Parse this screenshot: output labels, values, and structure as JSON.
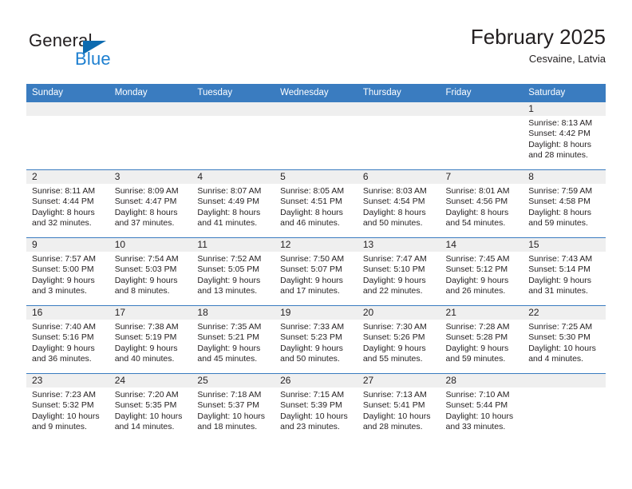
{
  "brand": {
    "name_part1": "General",
    "name_part2": "Blue",
    "triangle_color": "#0d6bb0",
    "blue_color": "#1d7fd0"
  },
  "header": {
    "title": "February 2025",
    "location": "Cesvaine, Latvia"
  },
  "theme": {
    "header_row_bg": "#3a7cc0",
    "daynum_band_bg": "#efefef",
    "row_border": "#3a7cc0",
    "text": "#231f20"
  },
  "weekdays": [
    "Sunday",
    "Monday",
    "Tuesday",
    "Wednesday",
    "Thursday",
    "Friday",
    "Saturday"
  ],
  "weeks": [
    [
      {
        "day": "",
        "blank": true,
        "sunrise": "",
        "sunset": "",
        "daylight_l1": "",
        "daylight_l2": ""
      },
      {
        "day": "",
        "blank": true,
        "sunrise": "",
        "sunset": "",
        "daylight_l1": "",
        "daylight_l2": ""
      },
      {
        "day": "",
        "blank": true,
        "sunrise": "",
        "sunset": "",
        "daylight_l1": "",
        "daylight_l2": ""
      },
      {
        "day": "",
        "blank": true,
        "sunrise": "",
        "sunset": "",
        "daylight_l1": "",
        "daylight_l2": ""
      },
      {
        "day": "",
        "blank": true,
        "sunrise": "",
        "sunset": "",
        "daylight_l1": "",
        "daylight_l2": ""
      },
      {
        "day": "",
        "blank": true,
        "sunrise": "",
        "sunset": "",
        "daylight_l1": "",
        "daylight_l2": ""
      },
      {
        "day": "1",
        "blank": false,
        "sunrise": "Sunrise: 8:13 AM",
        "sunset": "Sunset: 4:42 PM",
        "daylight_l1": "Daylight: 8 hours",
        "daylight_l2": "and 28 minutes."
      }
    ],
    [
      {
        "day": "2",
        "blank": false,
        "sunrise": "Sunrise: 8:11 AM",
        "sunset": "Sunset: 4:44 PM",
        "daylight_l1": "Daylight: 8 hours",
        "daylight_l2": "and 32 minutes."
      },
      {
        "day": "3",
        "blank": false,
        "sunrise": "Sunrise: 8:09 AM",
        "sunset": "Sunset: 4:47 PM",
        "daylight_l1": "Daylight: 8 hours",
        "daylight_l2": "and 37 minutes."
      },
      {
        "day": "4",
        "blank": false,
        "sunrise": "Sunrise: 8:07 AM",
        "sunset": "Sunset: 4:49 PM",
        "daylight_l1": "Daylight: 8 hours",
        "daylight_l2": "and 41 minutes."
      },
      {
        "day": "5",
        "blank": false,
        "sunrise": "Sunrise: 8:05 AM",
        "sunset": "Sunset: 4:51 PM",
        "daylight_l1": "Daylight: 8 hours",
        "daylight_l2": "and 46 minutes."
      },
      {
        "day": "6",
        "blank": false,
        "sunrise": "Sunrise: 8:03 AM",
        "sunset": "Sunset: 4:54 PM",
        "daylight_l1": "Daylight: 8 hours",
        "daylight_l2": "and 50 minutes."
      },
      {
        "day": "7",
        "blank": false,
        "sunrise": "Sunrise: 8:01 AM",
        "sunset": "Sunset: 4:56 PM",
        "daylight_l1": "Daylight: 8 hours",
        "daylight_l2": "and 54 minutes."
      },
      {
        "day": "8",
        "blank": false,
        "sunrise": "Sunrise: 7:59 AM",
        "sunset": "Sunset: 4:58 PM",
        "daylight_l1": "Daylight: 8 hours",
        "daylight_l2": "and 59 minutes."
      }
    ],
    [
      {
        "day": "9",
        "blank": false,
        "sunrise": "Sunrise: 7:57 AM",
        "sunset": "Sunset: 5:00 PM",
        "daylight_l1": "Daylight: 9 hours",
        "daylight_l2": "and 3 minutes."
      },
      {
        "day": "10",
        "blank": false,
        "sunrise": "Sunrise: 7:54 AM",
        "sunset": "Sunset: 5:03 PM",
        "daylight_l1": "Daylight: 9 hours",
        "daylight_l2": "and 8 minutes."
      },
      {
        "day": "11",
        "blank": false,
        "sunrise": "Sunrise: 7:52 AM",
        "sunset": "Sunset: 5:05 PM",
        "daylight_l1": "Daylight: 9 hours",
        "daylight_l2": "and 13 minutes."
      },
      {
        "day": "12",
        "blank": false,
        "sunrise": "Sunrise: 7:50 AM",
        "sunset": "Sunset: 5:07 PM",
        "daylight_l1": "Daylight: 9 hours",
        "daylight_l2": "and 17 minutes."
      },
      {
        "day": "13",
        "blank": false,
        "sunrise": "Sunrise: 7:47 AM",
        "sunset": "Sunset: 5:10 PM",
        "daylight_l1": "Daylight: 9 hours",
        "daylight_l2": "and 22 minutes."
      },
      {
        "day": "14",
        "blank": false,
        "sunrise": "Sunrise: 7:45 AM",
        "sunset": "Sunset: 5:12 PM",
        "daylight_l1": "Daylight: 9 hours",
        "daylight_l2": "and 26 minutes."
      },
      {
        "day": "15",
        "blank": false,
        "sunrise": "Sunrise: 7:43 AM",
        "sunset": "Sunset: 5:14 PM",
        "daylight_l1": "Daylight: 9 hours",
        "daylight_l2": "and 31 minutes."
      }
    ],
    [
      {
        "day": "16",
        "blank": false,
        "sunrise": "Sunrise: 7:40 AM",
        "sunset": "Sunset: 5:16 PM",
        "daylight_l1": "Daylight: 9 hours",
        "daylight_l2": "and 36 minutes."
      },
      {
        "day": "17",
        "blank": false,
        "sunrise": "Sunrise: 7:38 AM",
        "sunset": "Sunset: 5:19 PM",
        "daylight_l1": "Daylight: 9 hours",
        "daylight_l2": "and 40 minutes."
      },
      {
        "day": "18",
        "blank": false,
        "sunrise": "Sunrise: 7:35 AM",
        "sunset": "Sunset: 5:21 PM",
        "daylight_l1": "Daylight: 9 hours",
        "daylight_l2": "and 45 minutes."
      },
      {
        "day": "19",
        "blank": false,
        "sunrise": "Sunrise: 7:33 AM",
        "sunset": "Sunset: 5:23 PM",
        "daylight_l1": "Daylight: 9 hours",
        "daylight_l2": "and 50 minutes."
      },
      {
        "day": "20",
        "blank": false,
        "sunrise": "Sunrise: 7:30 AM",
        "sunset": "Sunset: 5:26 PM",
        "daylight_l1": "Daylight: 9 hours",
        "daylight_l2": "and 55 minutes."
      },
      {
        "day": "21",
        "blank": false,
        "sunrise": "Sunrise: 7:28 AM",
        "sunset": "Sunset: 5:28 PM",
        "daylight_l1": "Daylight: 9 hours",
        "daylight_l2": "and 59 minutes."
      },
      {
        "day": "22",
        "blank": false,
        "sunrise": "Sunrise: 7:25 AM",
        "sunset": "Sunset: 5:30 PM",
        "daylight_l1": "Daylight: 10 hours",
        "daylight_l2": "and 4 minutes."
      }
    ],
    [
      {
        "day": "23",
        "blank": false,
        "sunrise": "Sunrise: 7:23 AM",
        "sunset": "Sunset: 5:32 PM",
        "daylight_l1": "Daylight: 10 hours",
        "daylight_l2": "and 9 minutes."
      },
      {
        "day": "24",
        "blank": false,
        "sunrise": "Sunrise: 7:20 AM",
        "sunset": "Sunset: 5:35 PM",
        "daylight_l1": "Daylight: 10 hours",
        "daylight_l2": "and 14 minutes."
      },
      {
        "day": "25",
        "blank": false,
        "sunrise": "Sunrise: 7:18 AM",
        "sunset": "Sunset: 5:37 PM",
        "daylight_l1": "Daylight: 10 hours",
        "daylight_l2": "and 18 minutes."
      },
      {
        "day": "26",
        "blank": false,
        "sunrise": "Sunrise: 7:15 AM",
        "sunset": "Sunset: 5:39 PM",
        "daylight_l1": "Daylight: 10 hours",
        "daylight_l2": "and 23 minutes."
      },
      {
        "day": "27",
        "blank": false,
        "sunrise": "Sunrise: 7:13 AM",
        "sunset": "Sunset: 5:41 PM",
        "daylight_l1": "Daylight: 10 hours",
        "daylight_l2": "and 28 minutes."
      },
      {
        "day": "28",
        "blank": false,
        "sunrise": "Sunrise: 7:10 AM",
        "sunset": "Sunset: 5:44 PM",
        "daylight_l1": "Daylight: 10 hours",
        "daylight_l2": "and 33 minutes."
      },
      {
        "day": "",
        "blank": true,
        "sunrise": "",
        "sunset": "",
        "daylight_l1": "",
        "daylight_l2": ""
      }
    ]
  ]
}
